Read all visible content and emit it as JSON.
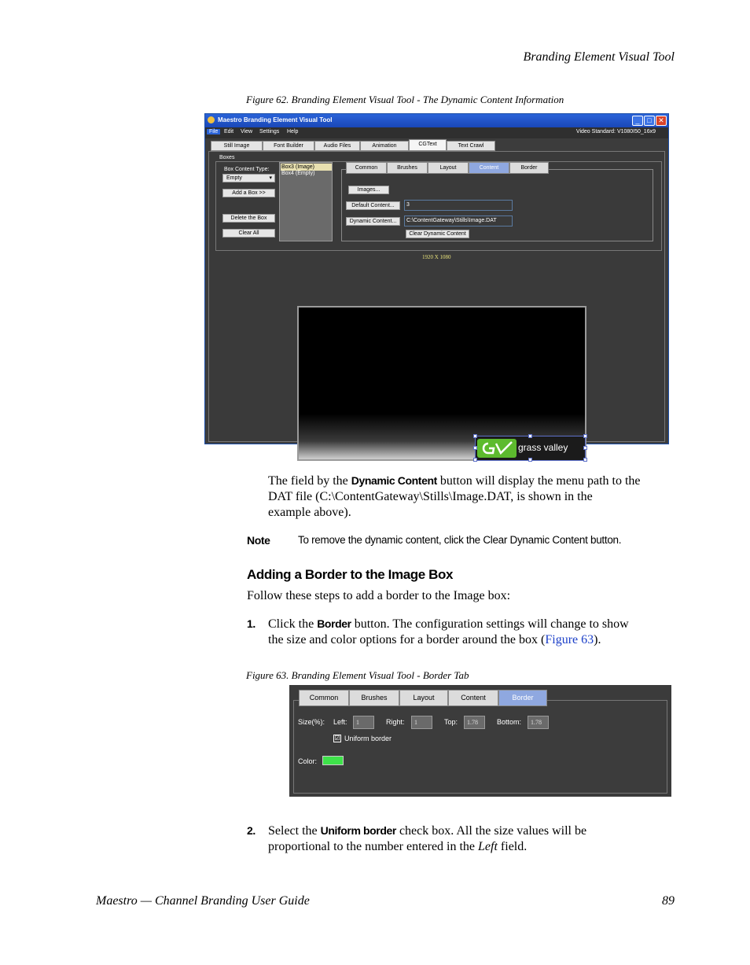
{
  "running_header": "Branding Element Visual Tool",
  "figure62": {
    "caption": "Figure 62.  Branding Element Visual Tool - The Dynamic Content Information",
    "window": {
      "title": "Maestro Branding Element Visual Tool",
      "title_controls": {
        "minimize": "_",
        "maximize": "□",
        "close": "✕"
      },
      "menus": [
        "File",
        "Edit",
        "View",
        "Settings",
        "Help"
      ],
      "video_standard": "Video Standard: V1080I50_16x9",
      "tabs": [
        "Still Image",
        "Font Builder",
        "Audio Files",
        "Animation",
        "CGText",
        "Text Crawl"
      ],
      "active_tab": "CGText",
      "boxes_group": "Boxes",
      "box_content_type_label": "Box Content Type:",
      "box_content_type_value": "Empty",
      "list_items": [
        "Box3 (Image)",
        "Box4 (Empty)"
      ],
      "add_box": "Add a Box >>",
      "delete_box": "Delete the Box",
      "clear_all": "Clear All",
      "subtabs": [
        "Common",
        "Brushes",
        "Layout",
        "Content",
        "Border"
      ],
      "active_subtab": "Content",
      "images_btn": "Images...",
      "default_content_btn": "Default Content...",
      "default_content_value": "3",
      "dynamic_content_btn": "Dynamic Content...",
      "dynamic_content_value": "C:\\ContentGateway\\Stills\\Image.DAT",
      "clear_dynamic_btn": "Clear Dynamic Content",
      "resolution": "1920 X 1080",
      "logo_text": "grass valley"
    }
  },
  "para1": {
    "a": "The field by the ",
    "b": "Dynamic Content",
    "c": " button will display the menu path to the",
    "line2": "DAT file (C:\\ContentGateway\\Stills\\Image.DAT, is shown in the",
    "line3": "example above)."
  },
  "note": {
    "label": "Note",
    "text": "To remove the dynamic content, click the Clear Dynamic Content button."
  },
  "section_heading": "Adding a Border to the Image Box",
  "intro": "Follow these steps to add a border to the Image box:",
  "step1": {
    "num": "1.",
    "a": "Click the ",
    "b": "Border",
    "c": " button. The configuration settings will change to show",
    "line2a": "the size and color options for a border around the box (",
    "link": "Figure 63",
    "line2b": ")."
  },
  "figure63": {
    "caption": "Figure 63.  Branding Element Visual Tool - Border Tab",
    "tabs": [
      "Common",
      "Brushes",
      "Layout",
      "Content",
      "Border"
    ],
    "active_tab": "Border",
    "size_label": "Size(%):",
    "left_label": "Left:",
    "left_value": "1",
    "right_label": "Right:",
    "right_value": "1",
    "top_label": "Top:",
    "top_value": "1.78",
    "bottom_label": "Bottom:",
    "bottom_value": "1.78",
    "uniform_label": "Uniform border",
    "uniform_checked": "☑",
    "color_label": "Color:",
    "color_value": "#3ee24a"
  },
  "step2": {
    "num": "2.",
    "a": "Select the ",
    "b": "Uniform border",
    "c": " check box. All the size values will be",
    "line2a": "proportional to the number entered in the ",
    "line2i": "Left",
    "line2b": " field."
  },
  "footer": {
    "left": "Maestro  —  Channel Branding User Guide",
    "page": "89"
  }
}
